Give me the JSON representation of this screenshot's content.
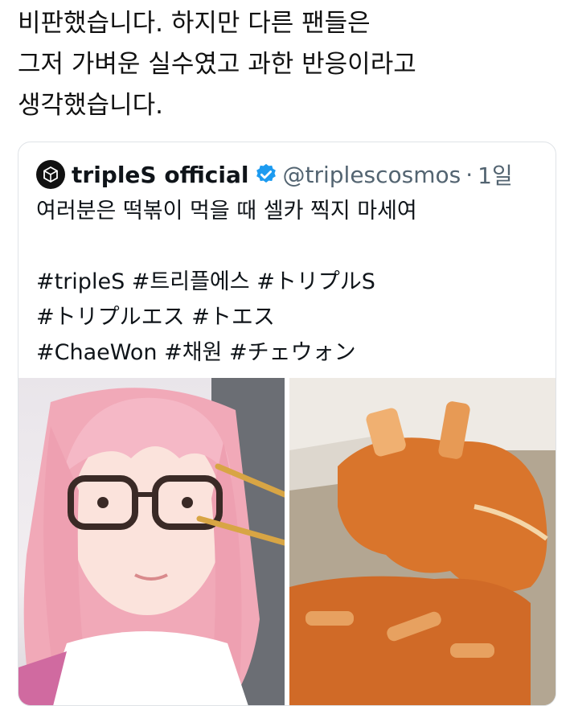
{
  "caption": {
    "lines": [
      "비판했습니다. 하지만 다른 팬들은",
      "그저 가벼운 실수였고 과한 반응이라고",
      "생각했습니다."
    ]
  },
  "tweet": {
    "display_name": "tripleS official",
    "handle": "@triplescosmos",
    "separator": "·",
    "time": "1일",
    "text_lines": [
      "여러분은 떡볶이 먹을 때 셀카 찍지 마세여",
      "",
      "#tripleS #트리플에스 #トリプルS",
      "#トリプルエス #トエス",
      "#ChaeWon #채원 #チェウォン"
    ]
  },
  "colors": {
    "verified_badge": "#1d9bf0",
    "secondary_text": "#536471",
    "tteokbokki_sauce": "#d9752c"
  },
  "icons": {
    "avatar": "triples-logo-icon",
    "verified": "verified-badge-icon"
  }
}
